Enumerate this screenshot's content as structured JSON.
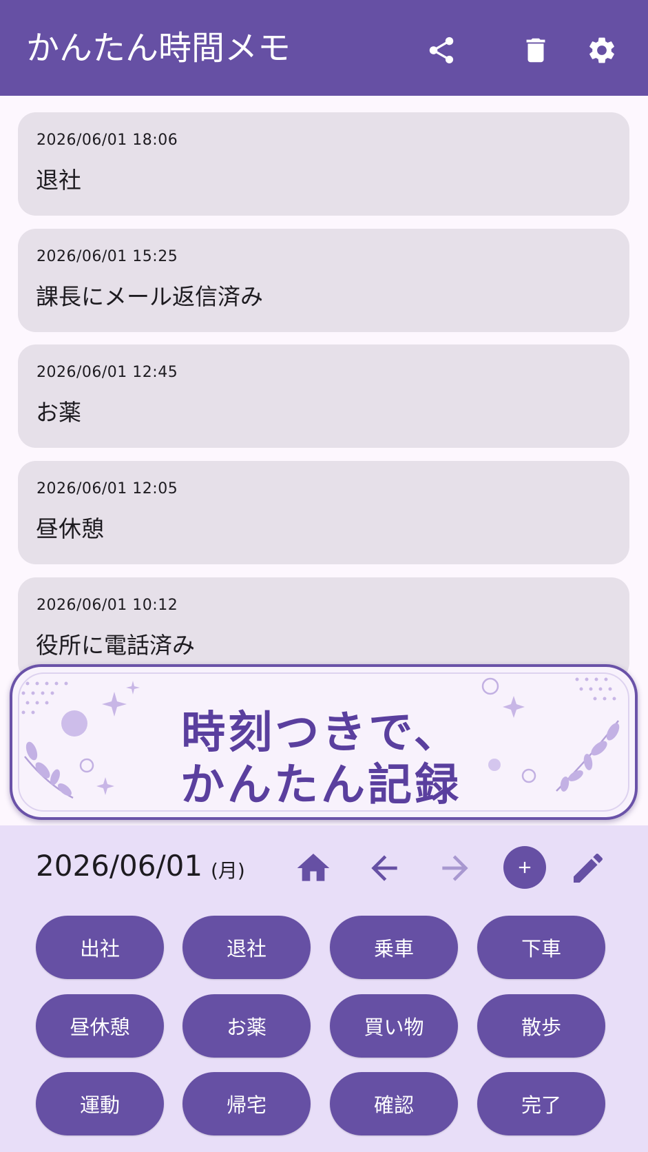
{
  "app": {
    "title": "かんたん時間メモ",
    "actions": [
      {
        "name": "share-icon",
        "label": "共有"
      },
      {
        "name": "trash-icon",
        "label": "削除"
      },
      {
        "name": "gear-icon",
        "label": "設定"
      }
    ]
  },
  "entries": [
    {
      "time": "2026/06/01 18:06",
      "text": "退社"
    },
    {
      "time": "2026/06/01 15:25",
      "text": "課長にメール返信済み"
    },
    {
      "time": "2026/06/01 12:45",
      "text": "お薬"
    },
    {
      "time": "2026/06/01 12:05",
      "text": "昼休憩"
    },
    {
      "time": "2026/06/01 10:12",
      "text": "役所に電話済み"
    }
  ],
  "banner": {
    "line1": "時刻つきで、",
    "line2": "かんたん記録"
  },
  "footer": {
    "date": "2026/06/01",
    "weekday": "(月)",
    "nav_icons": [
      "home-icon",
      "arrow-left-icon",
      "arrow-right-icon",
      "add-icon",
      "pencil-icon"
    ],
    "quick_buttons": [
      "出社",
      "退社",
      "乗車",
      "下車",
      "昼休憩",
      "お薬",
      "買い物",
      "散歩",
      "運動",
      "帰宅",
      "確認",
      "完了"
    ]
  },
  "colors": {
    "primary": "#6650a4",
    "card": "#e6e0e9",
    "footer_bg": "#e8def8",
    "banner_text": "#5a3f9e",
    "disabled_arrow": "#a898d0"
  }
}
